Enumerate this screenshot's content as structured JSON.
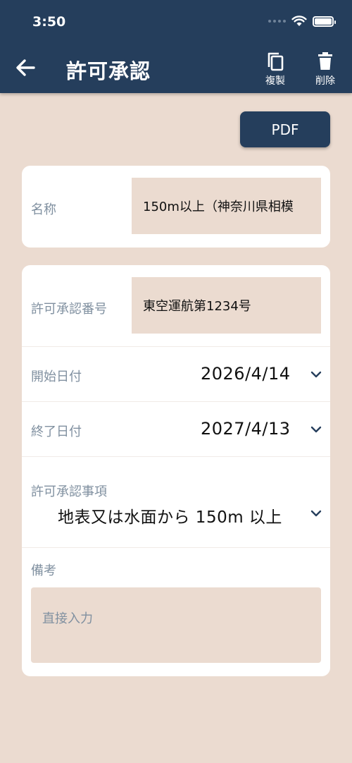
{
  "status_bar": {
    "time": "3:50"
  },
  "header": {
    "title": "許可承認",
    "copy_label": "複製",
    "delete_label": "削除"
  },
  "pdf_button": {
    "label": "PDF"
  },
  "name_card": {
    "label": "名称",
    "value": "150m以上（神奈川県相模"
  },
  "permit_card": {
    "number_label": "許可承認番号",
    "number_value": "東空運航第1234号",
    "start_label": "開始日付",
    "start_value": "2026/4/14",
    "end_label": "終了日付",
    "end_value": "2027/4/13",
    "matter_label": "許可承認事項",
    "matter_value": "地表又は水面から 150m 以上",
    "memo_label": "備考",
    "memo_placeholder": "直接入力"
  },
  "colors": {
    "header": "#253e5c",
    "background": "#ebdbd0",
    "label": "#8090a0"
  }
}
